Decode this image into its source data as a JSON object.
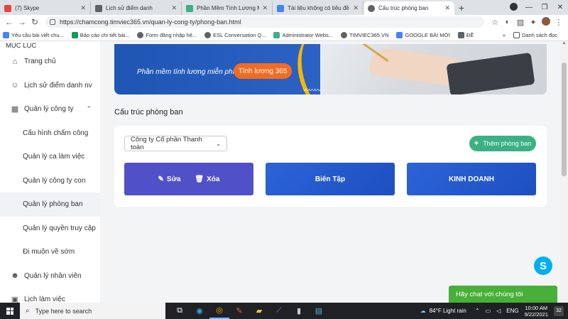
{
  "browser": {
    "tabs": [
      {
        "title": "(7) Skype",
        "color": "#e8453c"
      },
      {
        "title": "Lịch sử điểm danh",
        "color": "#5f6368"
      },
      {
        "title": "Phần Mềm Tính Lương Miễn",
        "color": "#3bb085"
      },
      {
        "title": "Tài liệu không có tiêu đề - Go",
        "color": "#4285f4"
      },
      {
        "title": "Cấu trúc phòng ban",
        "color": "#5f6368"
      }
    ],
    "new_tab": "+",
    "url": "https://chamcong.timviec365.vn/quan-ly-cong-ty/phong-ban.html",
    "bookmarks": [
      {
        "label": "Yêu cầu bài viết chu...",
        "color": "#4285f4"
      },
      {
        "label": "Báo cáo chi tiết bài...",
        "color": "#0f9d58"
      },
      {
        "label": "Form đăng nhập hệ...",
        "color": "#5f6368"
      },
      {
        "label": "ESL Conversation Q...",
        "color": "#5f6368"
      },
      {
        "label": "Administrator Webs...",
        "color": "#3bb085"
      },
      {
        "label": "TIMVIEC365.VN",
        "color": "#5f6368"
      },
      {
        "label": "GOOGLE BÀI MỚI",
        "color": "#4285f4"
      },
      {
        "label": "ĐỀ",
        "color": "#5f6368"
      }
    ],
    "bookmarks_more": "»",
    "reading_list": "Danh sách đọc"
  },
  "sidebar": {
    "heading": "MỤC LỤC",
    "items": [
      {
        "label": "Trang chủ",
        "icon": "home-icon",
        "glyph": "⌂"
      },
      {
        "label": "Lịch sử điểm danh nv",
        "icon": "user-clock-icon",
        "glyph": "☺"
      },
      {
        "label": "Quản lý công ty",
        "icon": "building-icon",
        "glyph": "▦",
        "chevron": "^"
      },
      {
        "label": "Cấu hình chấm công"
      },
      {
        "label": "Quản lý ca làm việc"
      },
      {
        "label": "Quản lý công ty con"
      },
      {
        "label": "Quản lý phòng ban"
      },
      {
        "label": "Quản lý quyền truy cập"
      },
      {
        "label": "Đi muộn về sớm"
      },
      {
        "label": "Quản lý nhân viên",
        "icon": "users-icon",
        "glyph": "☻"
      },
      {
        "label": "Lịch làm việc",
        "icon": "calendar-icon",
        "glyph": "▣"
      }
    ]
  },
  "banner": {
    "tagline": "Phần mềm tính lương miễn phí",
    "cta": "Tính lương 365"
  },
  "page": {
    "title": "Cấu trúc phòng ban",
    "company_select": "Công ty Cổ phần Thanh toán",
    "add_button": "Thêm phòng ban",
    "edit_label": "Sửa",
    "delete_label": "Xóa",
    "departments": [
      "Biên Tập",
      "KINH DOANH"
    ]
  },
  "chat": {
    "label": "Hãy chat với chúng tôi"
  },
  "taskbar": {
    "search_placeholder": "Type here to search",
    "weather": "84°F  Light rain",
    "language": "ENG",
    "time": "10:00 AM",
    "date": "9/22/2021",
    "notifications": "32"
  }
}
